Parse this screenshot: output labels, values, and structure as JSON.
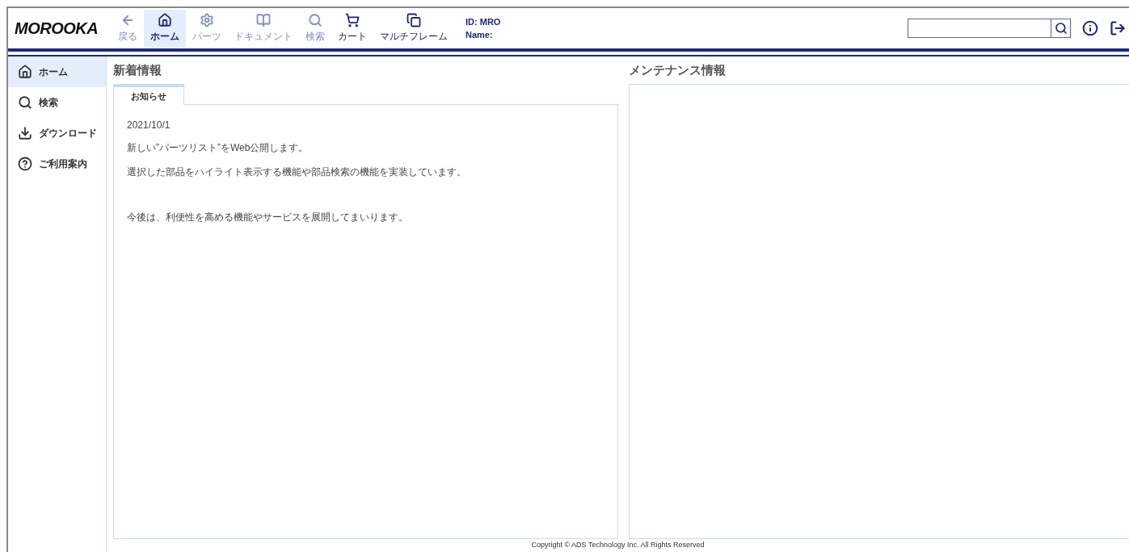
{
  "logo": "MOROOKA",
  "toolbar": [
    {
      "label": "戻る",
      "kind": "back",
      "selected": false,
      "disabled": true
    },
    {
      "label": "ホーム",
      "kind": "home",
      "selected": true,
      "disabled": false
    },
    {
      "label": "パーツ",
      "kind": "parts",
      "selected": false,
      "disabled": true
    },
    {
      "label": "ドキュメント",
      "kind": "document",
      "selected": false,
      "disabled": true
    },
    {
      "label": "検索",
      "kind": "search",
      "selected": false,
      "disabled": true
    },
    {
      "label": "カート",
      "kind": "cart",
      "selected": false,
      "disabled": false
    },
    {
      "label": "マルチフレーム",
      "kind": "multiframe",
      "selected": false,
      "disabled": false
    }
  ],
  "user": {
    "id": "ID: MRO",
    "name": "Name:"
  },
  "sidebar": {
    "items": [
      {
        "label": "ホーム",
        "kind": "home",
        "selected": true
      },
      {
        "label": "検索",
        "kind": "search",
        "selected": false
      },
      {
        "label": "ダウンロード",
        "kind": "download",
        "selected": false
      },
      {
        "label": "ご利用案内",
        "kind": "help",
        "selected": false
      }
    ]
  },
  "news": {
    "title": "新着情報",
    "tabs": [
      {
        "label": "お知らせ",
        "selected": true
      }
    ],
    "date": "2021/10/1",
    "paragraphs": [
      "新しい”パーツリスト”をWeb公開します。",
      "選択した部品をハイライト表示する機能や部品検索の機能を実装しています。",
      "今後は、利便性を高める機能やサービスを展開してまいります。"
    ]
  },
  "maintenance": {
    "title": "メンテナンス情報"
  },
  "footer": "Copyright © ADS Technology Inc. All Rights Reserved"
}
